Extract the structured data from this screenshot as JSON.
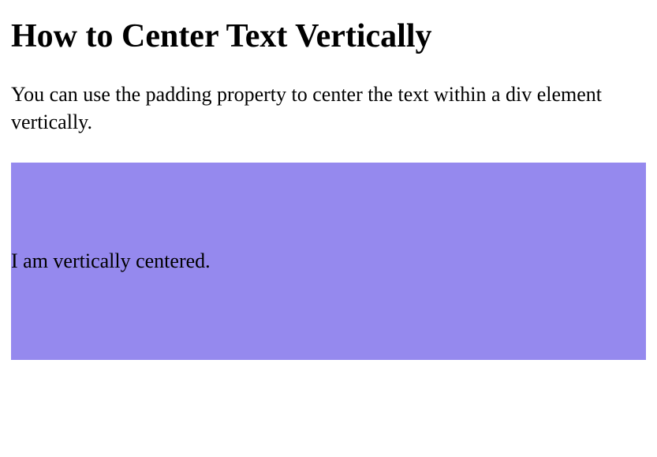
{
  "heading": "How to Center Text Vertically",
  "description": "You can use the padding property to center the text within a div element vertically.",
  "box_text": "I am vertically centered."
}
